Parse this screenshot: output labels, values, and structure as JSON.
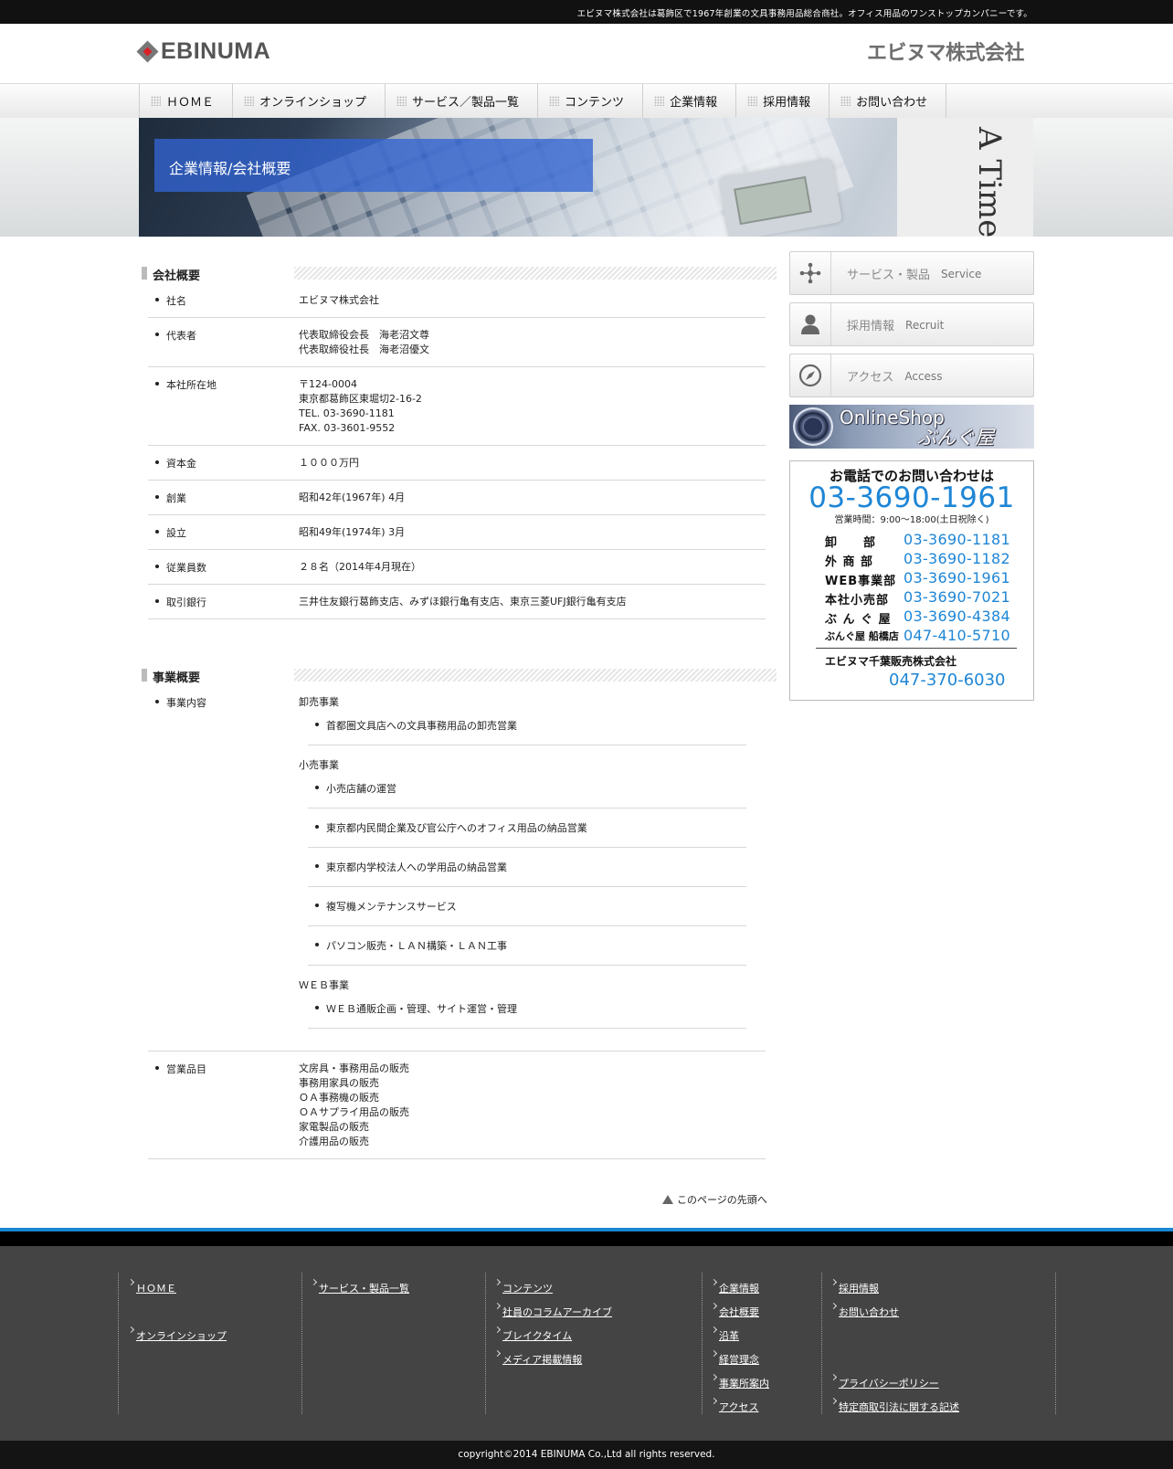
{
  "topbar": {
    "text": "エビヌマ株式会社は葛飾区で1967年創業の文具事務用品総合商社。オフィス用品のワンストップカンパニーです。"
  },
  "header": {
    "logo_text": "EBINUMA",
    "corp_name": "エビヌマ株式会社"
  },
  "nav": {
    "items": [
      "ＨＯＭＥ",
      "オンラインショップ",
      "サービス／製品一覧",
      "コンテンツ",
      "企業情報",
      "採用情報",
      "お問い合わせ"
    ]
  },
  "hero": {
    "title": "企業情報/会社概要",
    "paper_text": "A Time And a Ti"
  },
  "company": {
    "heading": "会社概要",
    "rows": [
      {
        "key": "社名",
        "val": "エビヌマ株式会社"
      },
      {
        "key": "代表者",
        "val1": "代表取締役会長　海老沼文尊",
        "val2": "代表取締役社長　海老沼優文"
      },
      {
        "key": "本社所在地",
        "val1": "〒124-0004",
        "val2": "東京都葛飾区東堀切2-16-2",
        "val3": "TEL. 03-3690-1181",
        "val4": "FAX. 03-3601-9552"
      },
      {
        "key": "資本金",
        "val": "１０００万円"
      },
      {
        "key": "創業",
        "val": "昭和42年(1967年) 4月"
      },
      {
        "key": "設立",
        "val": "昭和49年(1974年) 3月"
      },
      {
        "key": "従業員数",
        "val": "２８名（2014年4月現在）"
      },
      {
        "key": "取引銀行",
        "val": "三井住友銀行葛飾支店、みずほ銀行亀有支店、東京三菱UFJ銀行亀有支店"
      }
    ]
  },
  "business": {
    "heading": "事業概要",
    "content_key": "事業内容",
    "groups": [
      {
        "title": "卸売事業",
        "items": [
          "首都圏文具店への文具事務用品の卸売営業"
        ]
      },
      {
        "title": "小売事業",
        "items": [
          "小売店舗の運営",
          "東京都内民間企業及び官公庁へのオフィス用品の納品営業",
          "東京都内学校法人への学用品の納品営業",
          "複写機メンテナンスサービス",
          "パソコン販売・ＬＡＮ構築・ＬＡＮ工事"
        ]
      },
      {
        "title": "ＷＥＢ事業",
        "items": [
          "ＷＥＢ通販企画・管理、サイト運営・管理"
        ]
      }
    ],
    "products_key": "営業品目",
    "products": [
      "文房具・事務用品の販売",
      "事務用家具の販売",
      "ＯＡ事務機の販売",
      "ＯＡサプライ用品の販売",
      "家電製品の販売",
      "介護用品の販売"
    ]
  },
  "pagetop": "このページの先頭へ",
  "sidebar": {
    "buttons": [
      {
        "jp": "サービス・製品",
        "en": "Service",
        "icon": "network-icon"
      },
      {
        "jp": "採用情報",
        "en": "Recruit",
        "icon": "person-icon"
      },
      {
        "jp": "アクセス",
        "en": "Access",
        "icon": "compass-icon"
      }
    ],
    "shop_banner": {
      "line1": "OnlineShop",
      "line2": "ぶんぐ屋WEB"
    },
    "phone": {
      "title": "お電話でのお問い合わせは",
      "main_number": "03-3690-1961",
      "hours": "営業時間：9:00～18:00(土日祝除く)",
      "depts": [
        {
          "name": "卸　　部",
          "number": "03-3690-1181"
        },
        {
          "name": "外 商 部",
          "number": "03-3690-1182"
        },
        {
          "name": "WEB事業部",
          "number": "03-3690-1961"
        },
        {
          "name": "本社小売部",
          "number": "03-3690-7021"
        },
        {
          "name": "ぶ ん ぐ 屋",
          "number": "03-3690-4384"
        },
        {
          "name": "ぶんぐ屋 船橋店",
          "number": "047-410-5710"
        }
      ],
      "chiba_name": "エビヌマ千葉販売株式会社",
      "chiba_number": "047-370-6030"
    },
    "accent_color": "#1e86d6"
  },
  "footer": {
    "col1": [
      "ＨＯＭＥ",
      "オンラインショップ"
    ],
    "col2": [
      "サービス・製品一覧"
    ],
    "col3": [
      "コンテンツ",
      "社員のコラムアーカイブ",
      "ブレイクタイム",
      "メディア掲載情報"
    ],
    "col4": [
      "企業情報",
      "会社概要",
      "沿革",
      "経営理念",
      "事業所案内",
      "アクセス"
    ],
    "col5": [
      "採用情報",
      "お問い合わせ",
      "プライバシーポリシー",
      "特定商取引法に関する記述"
    ],
    "copyright": "copyright©2014 EBINUMA Co.,Ltd all rights reserved."
  }
}
